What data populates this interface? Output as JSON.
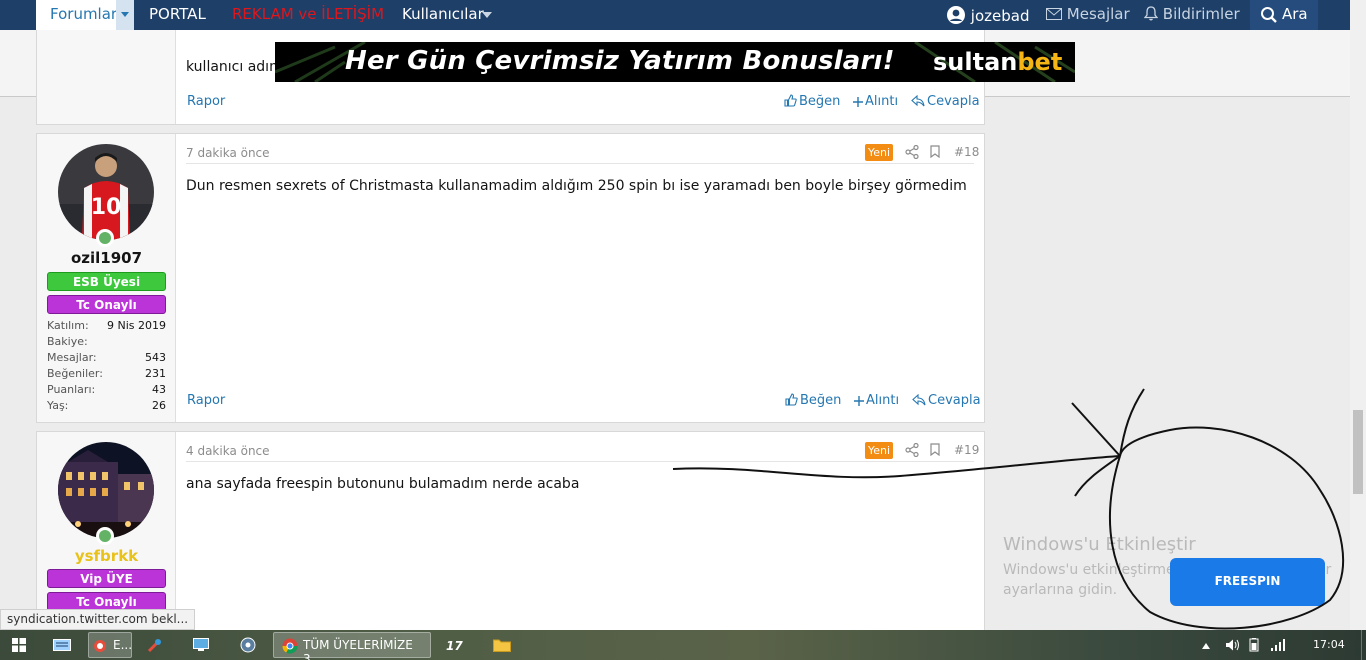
{
  "nav": {
    "forumlar": "Forumlar",
    "portal": "PORTAL",
    "reklam": "REKLAM ve İLETİŞİM",
    "kullanicilar": "Kullanıcılar",
    "user": "jozebad",
    "mesajlar": "Mesajlar",
    "bildirimler": "Bildirimler",
    "ara": "Ara"
  },
  "banner": {
    "text": "Her Gün Çevrimsiz Yatırım Bonusları!",
    "brand_a": "sultan",
    "brand_b": "bet"
  },
  "prev_post": {
    "text_fragment": "kullanıcı adım",
    "rapor": "Rapor",
    "like": "Beğen",
    "quote": "Alıntı",
    "reply": "Cevapla"
  },
  "posts": [
    {
      "time": "7 dakika önce",
      "badge_new": "Yeni",
      "number": "#18",
      "body": "Dun resmen sexrets of Christmasta kullanamadim aldığım 250 spin bı ise yaramadı ben boyle birşey görmedim",
      "username": "ozil1907",
      "badges": [
        "ESB Üyesi",
        "Tc Onaylı"
      ],
      "stats": [
        {
          "label": "Katılım:",
          "value": "9 Nis 2019"
        },
        {
          "label": "Bakiye:",
          "value": ""
        },
        {
          "label": "Mesajlar:",
          "value": "543"
        },
        {
          "label": "Beğeniler:",
          "value": "231"
        },
        {
          "label": "Puanları:",
          "value": "43"
        },
        {
          "label": "Yaş:",
          "value": "26"
        }
      ],
      "rapor": "Rapor",
      "like": "Beğen",
      "quote": "Alıntı",
      "reply": "Cevapla"
    },
    {
      "time": "4 dakika önce",
      "badge_new": "Yeni",
      "number": "#19",
      "body": "ana sayfada freespin butonunu bulamadım nerde acaba",
      "username": "ysfbrkk",
      "badges": [
        "Vip ÜYE",
        "Tc Onaylı"
      ]
    }
  ],
  "windows": {
    "title": "Windows'u Etkinleştir",
    "line1": "Windows'u etkinleştirmek için kişisel bilgisayar",
    "line2": "ayarlarına gidin."
  },
  "freespin": "FREESPIN",
  "status_url": "syndication.twitter.com bekl...",
  "taskbar": {
    "app1": "E...",
    "chrome_tab": "TÜM ÜYELERİMİZE 3...",
    "clock": "17:04"
  },
  "colors": {
    "nav_bg": "#1d3f68",
    "link": "#2577b1",
    "reklam_red": "#e0161b",
    "new_badge": "#f28c13",
    "freespin_blue": "#1a7ae8",
    "esb_green": "#3ec83e",
    "tc_purple": "#bb34d8",
    "ysfbrkk_gold": "#e8c21a"
  }
}
